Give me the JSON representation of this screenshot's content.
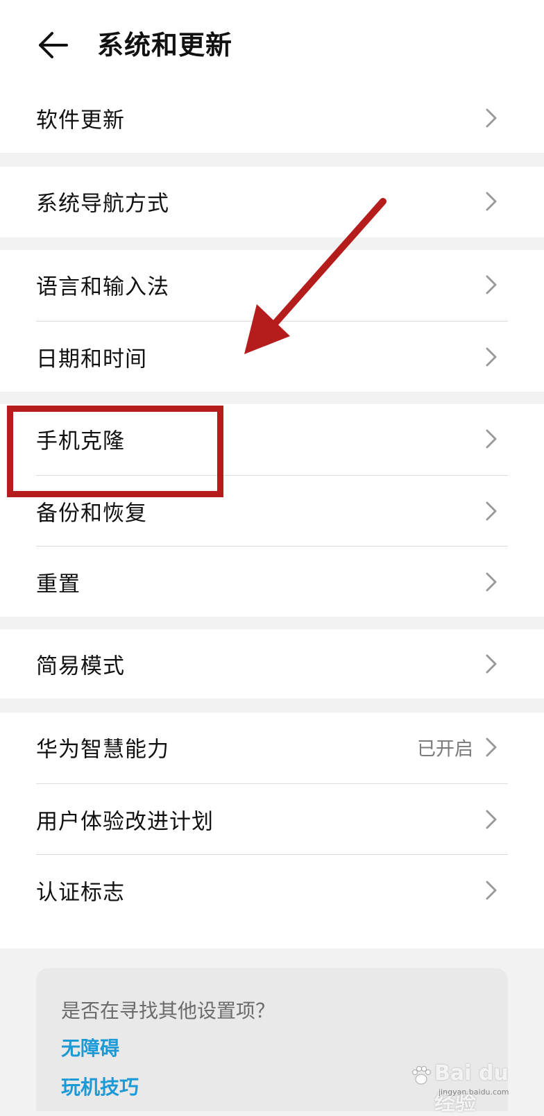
{
  "header": {
    "title": "系统和更新",
    "back_icon": "arrow-left-icon"
  },
  "groups": [
    {
      "items": [
        {
          "label": "软件更新"
        }
      ]
    },
    {
      "items": [
        {
          "label": "系统导航方式"
        }
      ]
    },
    {
      "items": [
        {
          "label": "语言和输入法"
        },
        {
          "label": "日期和时间"
        }
      ]
    },
    {
      "items": [
        {
          "label": "手机克隆"
        },
        {
          "label": "备份和恢复"
        },
        {
          "label": "重置"
        }
      ]
    },
    {
      "items": [
        {
          "label": "简易模式"
        }
      ]
    },
    {
      "items": [
        {
          "label": "华为智慧能力",
          "value": "已开启"
        },
        {
          "label": "用户体验改进计划"
        },
        {
          "label": "认证标志"
        }
      ]
    }
  ],
  "tip": {
    "question": "是否在寻找其他设置项？",
    "links": [
      "无障碍",
      "玩机技巧"
    ]
  },
  "colors": {
    "accent_link": "#1c9ad6",
    "annotation_red": "#b51c1c",
    "background": "#f2f2f2",
    "card": "#ffffff"
  },
  "annotation": {
    "highlighted_item": "手机克隆"
  },
  "watermark": {
    "brand": "Bai du 经验",
    "sub": "jingyan.baidu.com"
  }
}
